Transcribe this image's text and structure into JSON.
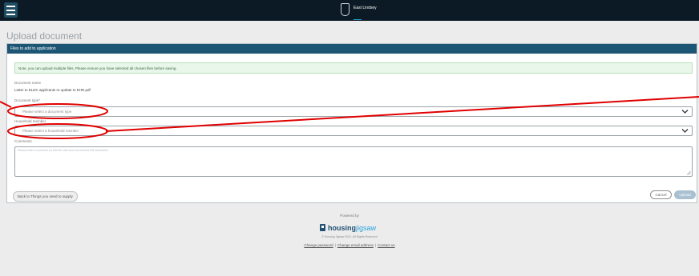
{
  "header": {
    "menu_icon": "hamburger-menu-icon",
    "logo_icon": "council-crest-icon",
    "brand_text": "East Lindsey"
  },
  "page": {
    "title": "Upload document"
  },
  "panel": {
    "heading": "Files to add to application",
    "note": "Note, you can upload multiple files. Please ensure you have selected all chosen files before saving.",
    "document_name_label": "Document name",
    "document_name_value": "Letter to ELDC applicants re update to EHR.pdf",
    "document_type_label": "Document type*",
    "document_type_value": "Please select a document type",
    "household_member_label": "Household member",
    "household_member_value": "Please select a household member",
    "comments_label": "Comments",
    "comments_placeholder": "Please enter a comment for this file; this must not exceed 255 characters"
  },
  "actions": {
    "back_label": "Back to Things you need to supply",
    "cancel_label": "Cancel",
    "upload_label": "Upload"
  },
  "footer": {
    "powered_by": "Powered by",
    "logo_main": "housing",
    "logo_accent": "jigsaw",
    "copyright": "© Housing Jigsaw 2021. All Rights Reserved",
    "links": [
      "Change password",
      "Change email address",
      "Contact us"
    ]
  },
  "colors": {
    "topbar": "#0b1a24",
    "panel_header": "#1d5674",
    "annotation_red": "#e00000",
    "brand_blue": "#1e4f73",
    "brand_accent": "#2aa2dd"
  }
}
